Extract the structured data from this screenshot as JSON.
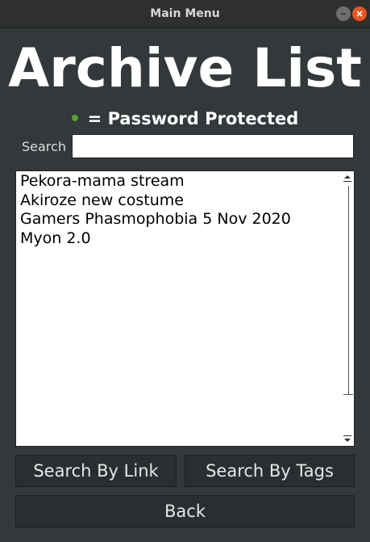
{
  "window": {
    "title": "Main Menu"
  },
  "heading": "Archive List",
  "legend": {
    "text": "= Password Protected",
    "dot_color": "#5aa02c"
  },
  "search": {
    "label": "Search",
    "value": "",
    "placeholder": ""
  },
  "archive_list": {
    "items": [
      "Pekora-mama stream",
      "Akiroze new costume",
      "Gamers Phasmophobia 5 Nov 2020",
      "Myon 2.0"
    ]
  },
  "buttons": {
    "search_by_link": "Search By Link",
    "search_by_tags": "Search By Tags",
    "back": "Back"
  },
  "colors": {
    "background": "#33393b",
    "close_button": "#e95420"
  }
}
